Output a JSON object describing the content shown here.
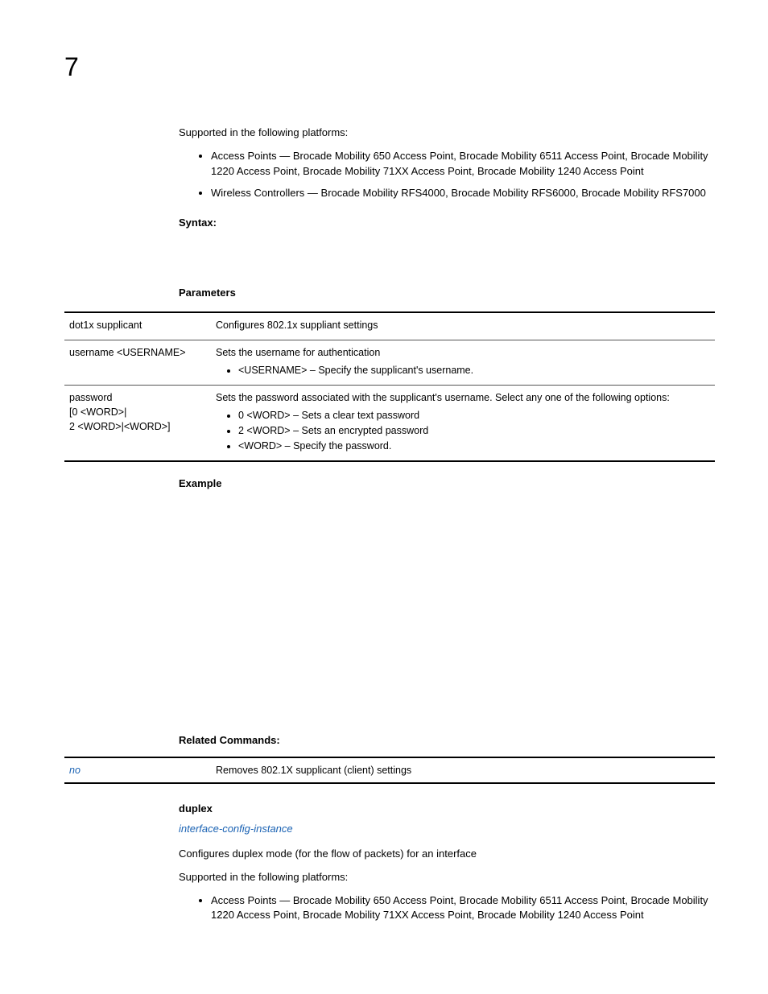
{
  "chapter": "7",
  "supported_intro": "Supported in the following platforms:",
  "bullets_top": [
    "Access Points — Brocade Mobility 650 Access Point, Brocade Mobility 6511 Access Point, Brocade Mobility 1220 Access Point, Brocade Mobility 71XX Access Point, Brocade Mobility 1240 Access Point",
    "Wireless Controllers — Brocade Mobility RFS4000, Brocade Mobility RFS6000, Brocade Mobility RFS7000"
  ],
  "syntax_label": "Syntax:",
  "parameters_label": "Parameters",
  "param_rows": [
    {
      "name": "dot1x supplicant",
      "desc": "Configures 802.1x suppliant settings",
      "items": []
    },
    {
      "name": "username <USERNAME>",
      "desc": "Sets the username for authentication",
      "items": [
        "<USERNAME> – Specify the supplicant's username."
      ]
    },
    {
      "name_lines": [
        "password",
        "[0 <WORD>|",
        "2 <WORD>|<WORD>]"
      ],
      "desc": "Sets the password associated with the supplicant's username. Select any one of the following options:",
      "items": [
        "0 <WORD> – Sets a clear text password",
        "2 <WORD> – Sets an encrypted password",
        "<WORD> – Specify the password."
      ]
    }
  ],
  "example_label": "Example",
  "related_label": "Related Commands:",
  "related_rows": [
    {
      "cmd": "no",
      "desc": "Removes 802.1X supplicant (client) settings"
    }
  ],
  "duplex": {
    "name": "duplex",
    "link": "interface-config-instance",
    "desc": "Configures duplex mode (for the flow of packets) for an interface",
    "supported_intro": "Supported in the following platforms:",
    "bullets": [
      "Access Points — Brocade Mobility 650 Access Point, Brocade Mobility 6511 Access Point, Brocade Mobility 1220 Access Point, Brocade Mobility 71XX Access Point, Brocade Mobility 1240 Access Point"
    ]
  }
}
